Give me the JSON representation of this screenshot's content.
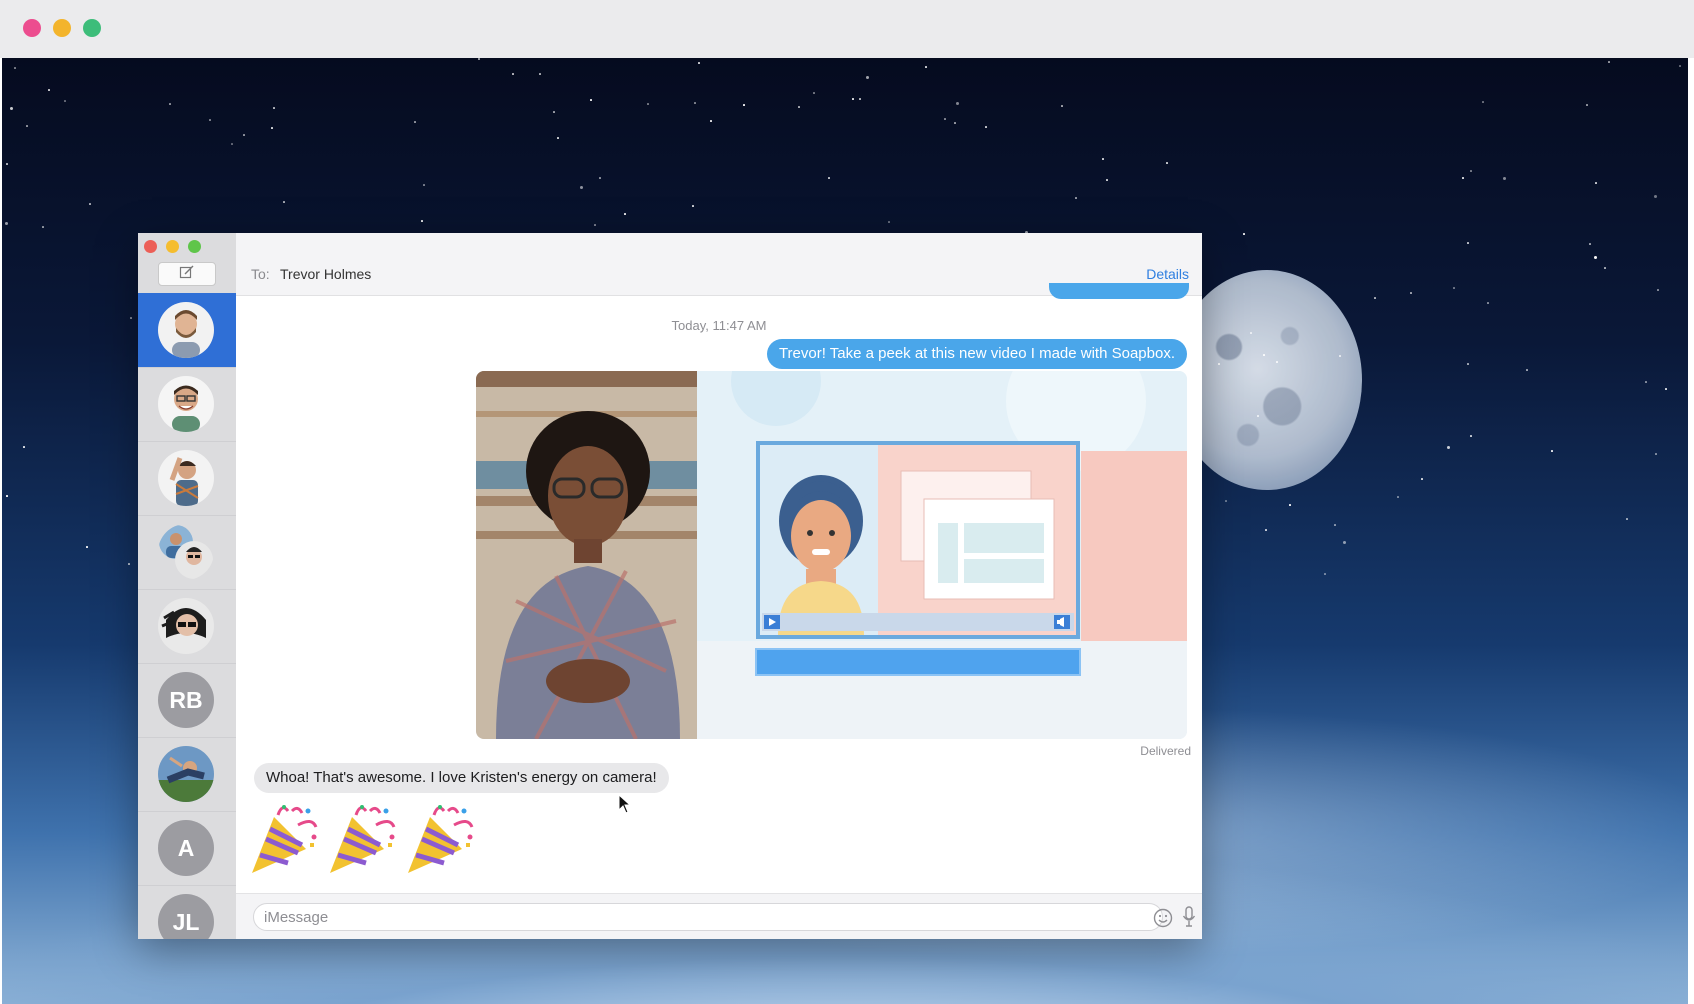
{
  "messages_app": {
    "header": {
      "to_label": "To:",
      "recipient": "Trevor Holmes",
      "details_link": "Details"
    },
    "sidebar": {
      "contacts": [
        {
          "type": "photo",
          "name": "contact-1",
          "active": true
        },
        {
          "type": "photo",
          "name": "contact-2"
        },
        {
          "type": "photo",
          "name": "contact-3"
        },
        {
          "type": "group-photo",
          "name": "contact-4"
        },
        {
          "type": "photo",
          "name": "contact-5"
        },
        {
          "type": "initials",
          "initials": "RB"
        },
        {
          "type": "photo",
          "name": "contact-7"
        },
        {
          "type": "initials",
          "initials": "A"
        },
        {
          "type": "initials",
          "initials": "JL"
        }
      ]
    },
    "conversation": {
      "timestamp": "Today, 11:47 AM",
      "outgoing_message": "Trevor! Take a peek at this new video I made with Soapbox.",
      "attachment": {
        "type": "video-preview"
      },
      "status": "Delivered",
      "incoming_message": "Whoa! That's awesome. I love Kristen's energy on camera!",
      "emoji_reaction": {
        "emoji": "party-popper",
        "count": 3
      }
    },
    "input": {
      "placeholder": "iMessage",
      "emoji_icon": "smiley-icon",
      "mic_icon": "microphone-icon"
    }
  },
  "colors": {
    "accent_blue": "#4aa6ea",
    "sidebar_active": "#2f6fd6",
    "incoming_bubble": "#e8e8ea",
    "link": "#2f7fe0",
    "traffic_red": "#ec5f57",
    "traffic_yellow": "#f5bd2f",
    "traffic_green": "#5fc54a",
    "browser_dot_pink": "#ec4d8f",
    "browser_dot_yellow": "#f3b42c",
    "browser_dot_green": "#3dbd7a"
  }
}
